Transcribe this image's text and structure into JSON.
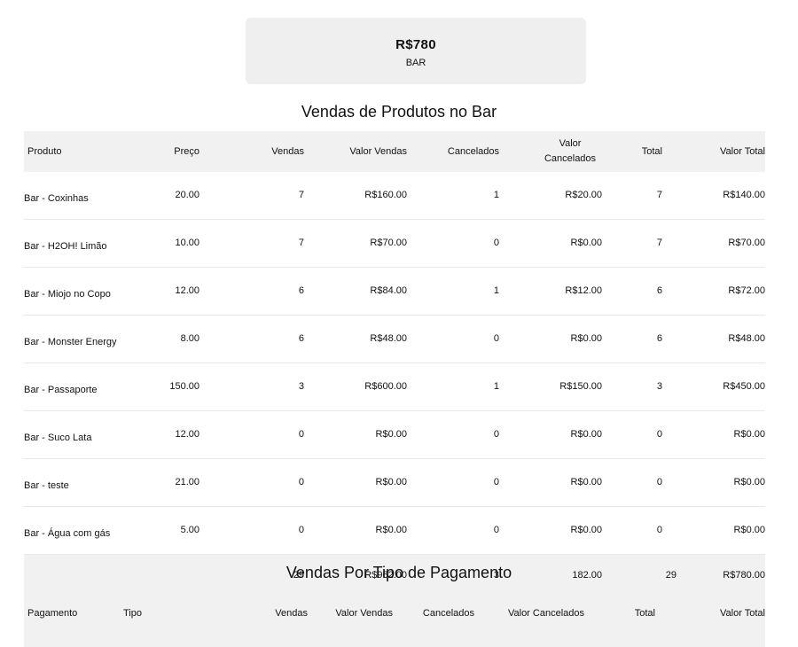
{
  "summary": {
    "value": "R$780",
    "label": "BAR"
  },
  "products": {
    "title": "Vendas de Produtos no Bar",
    "headers": [
      "Produto",
      "Preço",
      "Vendas",
      "Valor Vendas",
      "Cancelados",
      "Valor Cancelados",
      "Total",
      "Valor Total"
    ],
    "rows": [
      [
        "Bar - Coxinhas",
        "20.00",
        "7",
        "R$160.00",
        "1",
        "R$20.00",
        "7",
        "R$140.00"
      ],
      [
        "Bar - H2OH! Limão",
        "10.00",
        "7",
        "R$70.00",
        "0",
        "R$0.00",
        "7",
        "R$70.00"
      ],
      [
        "Bar - Miojo no Copo",
        "12.00",
        "6",
        "R$84.00",
        "1",
        "R$12.00",
        "6",
        "R$72.00"
      ],
      [
        "Bar - Monster Energy",
        "8.00",
        "6",
        "R$48.00",
        "0",
        "R$0.00",
        "6",
        "R$48.00"
      ],
      [
        "Bar - Passaporte",
        "150.00",
        "3",
        "R$600.00",
        "1",
        "R$150.00",
        "3",
        "R$450.00"
      ],
      [
        "Bar - Suco Lata",
        "12.00",
        "0",
        "R$0.00",
        "0",
        "R$0.00",
        "0",
        "R$0.00"
      ],
      [
        "Bar - teste",
        "21.00",
        "0",
        "R$0.00",
        "0",
        "R$0.00",
        "0",
        "R$0.00"
      ],
      [
        "Bar - Água com gás",
        "5.00",
        "0",
        "R$0.00",
        "0",
        "R$0.00",
        "0",
        "R$0.00"
      ]
    ],
    "totals": [
      "",
      "",
      "29",
      "R$962.00",
      "3",
      "182.00",
      "29",
      "R$780.00"
    ]
  },
  "payments": {
    "title": "Vendas Por Tipo de Pagamento",
    "headers": [
      "Pagamento",
      "Tipo",
      "Vendas",
      "Valor Vendas",
      "Cancelados",
      "Valor Cancelados",
      "Total",
      "Valor Total"
    ]
  }
}
